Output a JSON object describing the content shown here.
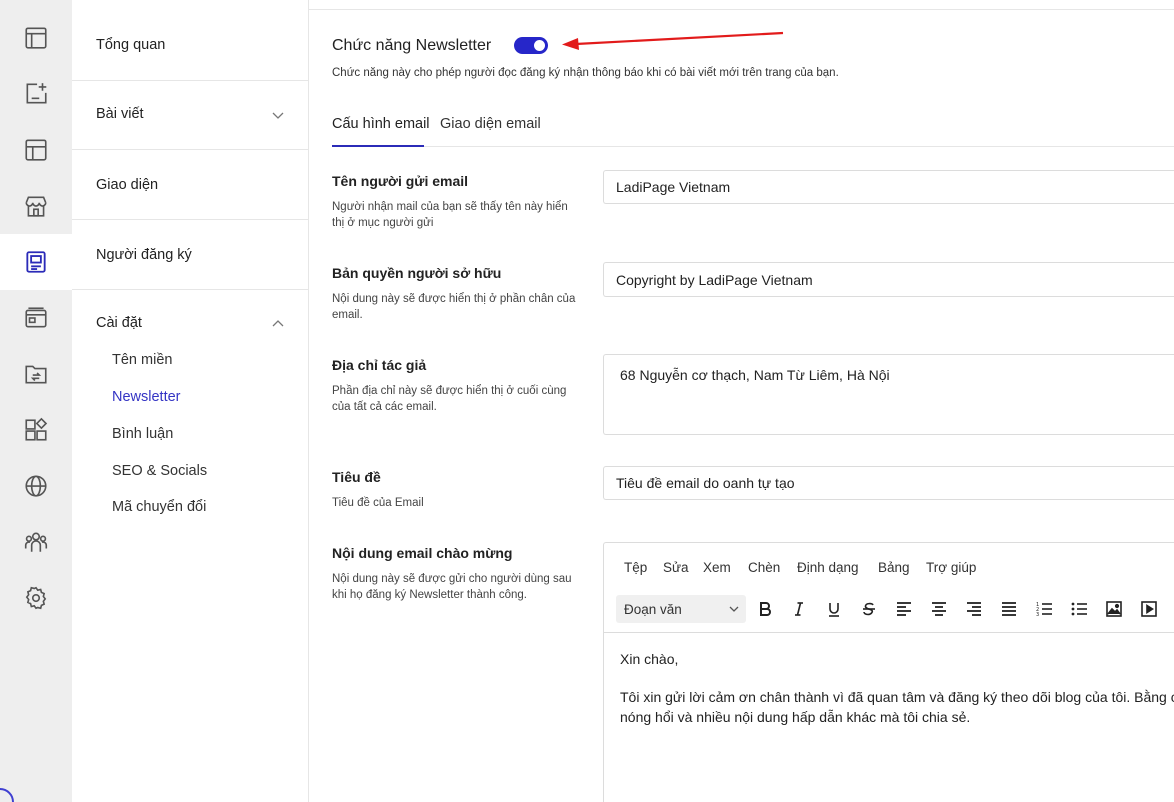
{
  "rail": {
    "icons": [
      "browser-window-icon",
      "add-post-icon",
      "layout-icon",
      "store-icon",
      "newsletter-icon",
      "browser-cards-icon",
      "folder-sync-icon",
      "apps-grid-icon",
      "globe-icon",
      "users-icon",
      "gear-icon"
    ],
    "active_index": 4
  },
  "subnav": {
    "items": [
      {
        "label": "Tổng quan"
      },
      {
        "label": "Bài viết"
      },
      {
        "label": "Giao diện"
      },
      {
        "label": "Người đăng ký"
      },
      {
        "label": "Cài đặt"
      }
    ],
    "settings_children": [
      "Tên miền",
      "Newsletter",
      "Bình luận",
      "SEO & Socials",
      "Mã chuyển đổi"
    ],
    "active_child": "Newsletter"
  },
  "feature": {
    "title": "Chức năng Newsletter",
    "enabled": true,
    "description": "Chức năng này cho phép người đọc đăng ký nhận thông báo khi có bài viết mới trên trang của bạn."
  },
  "tabs": [
    "Cấu hình email",
    "Giao diện email"
  ],
  "form": {
    "sender": {
      "label": "Tên người gửi email",
      "help": "Người nhận mail của bạn sẽ thấy tên này hiển thị ở mục người gửi",
      "value": "LadiPage Vietnam"
    },
    "copyright": {
      "label": "Bản quyền người sở hữu",
      "help": "Nội dung này sẽ được hiển thị ở phần chân của email.",
      "value": "Copyright by LadiPage Vietnam"
    },
    "address": {
      "label": "Địa chỉ tác giả",
      "help": "Phần địa chỉ này sẽ được hiển thị ở cuối cùng của tất cả các email.",
      "value": "68 Nguyễn cơ thạch, Nam Từ Liêm, Hà Nội"
    },
    "subject": {
      "label": "Tiêu đề",
      "help": "Tiêu đề của Email",
      "value": "Tiêu đề email do oanh tự tạo"
    },
    "welcome": {
      "label": "Nội dung email chào mừng",
      "help": "Nội dung này sẽ được gửi cho người dùng sau khi họ đăng ký Newsletter thành công."
    }
  },
  "editor": {
    "menu": [
      "Tệp",
      "Sửa",
      "Xem",
      "Chèn",
      "Định dạng",
      "Bảng",
      "Trợ giúp"
    ],
    "format_select": "Đoạn văn",
    "body_line1": "Xin chào,",
    "body_line2": "Tôi xin gửi lời cảm ơn chân thành vì đã quan tâm và đăng ký theo dõi blog của tôi. Bằng c",
    "body_line3": "nóng hổi và nhiều nội dung hấp dẫn khác mà tôi chia sẻ."
  }
}
